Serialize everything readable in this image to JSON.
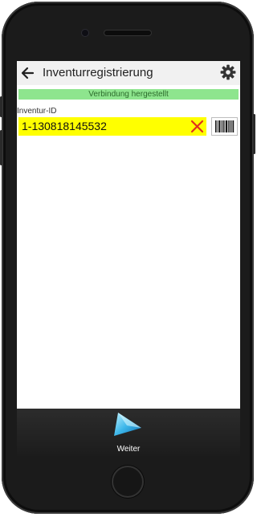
{
  "header": {
    "title": "Inventurregistrierung",
    "back_icon": "back-arrow-icon",
    "settings_icon": "gear-icon"
  },
  "status": {
    "text": "Verbindung hergestellt",
    "color": "#8ee58e"
  },
  "form": {
    "field_label": "Inventur-ID",
    "field_value": "1-130818145532",
    "field_bg": "#ffff00",
    "clear_icon": "close-icon",
    "scan_icon": "barcode-icon"
  },
  "footer": {
    "next_label": "Weiter",
    "next_icon": "play-triangle-icon"
  }
}
